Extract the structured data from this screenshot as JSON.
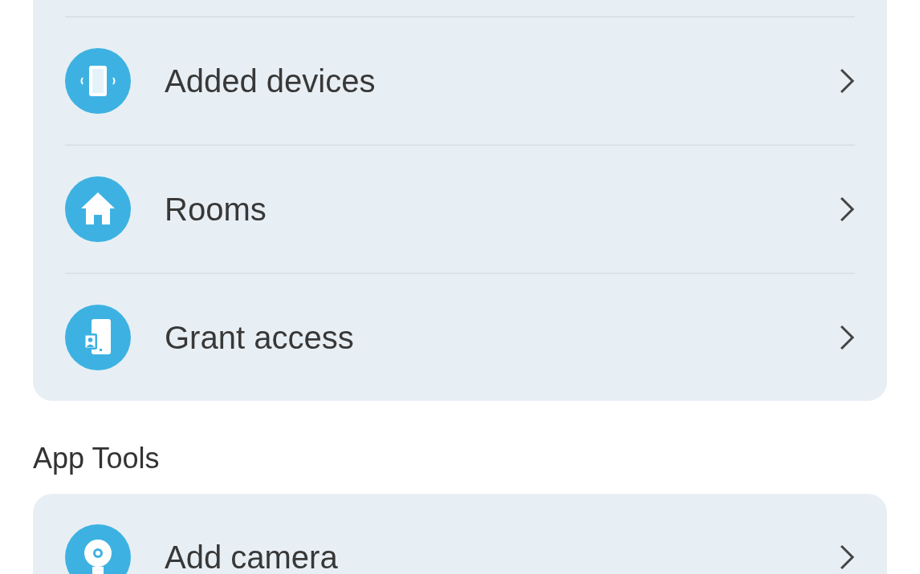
{
  "sections": [
    {
      "rows": [
        {
          "label": "Added devices",
          "kind": "devices"
        },
        {
          "label": "Rooms",
          "kind": "home"
        },
        {
          "label": "Grant access",
          "kind": "access"
        }
      ]
    },
    {
      "heading": "App Tools",
      "rows": [
        {
          "label": "Add camera",
          "kind": "camera"
        }
      ]
    }
  ]
}
